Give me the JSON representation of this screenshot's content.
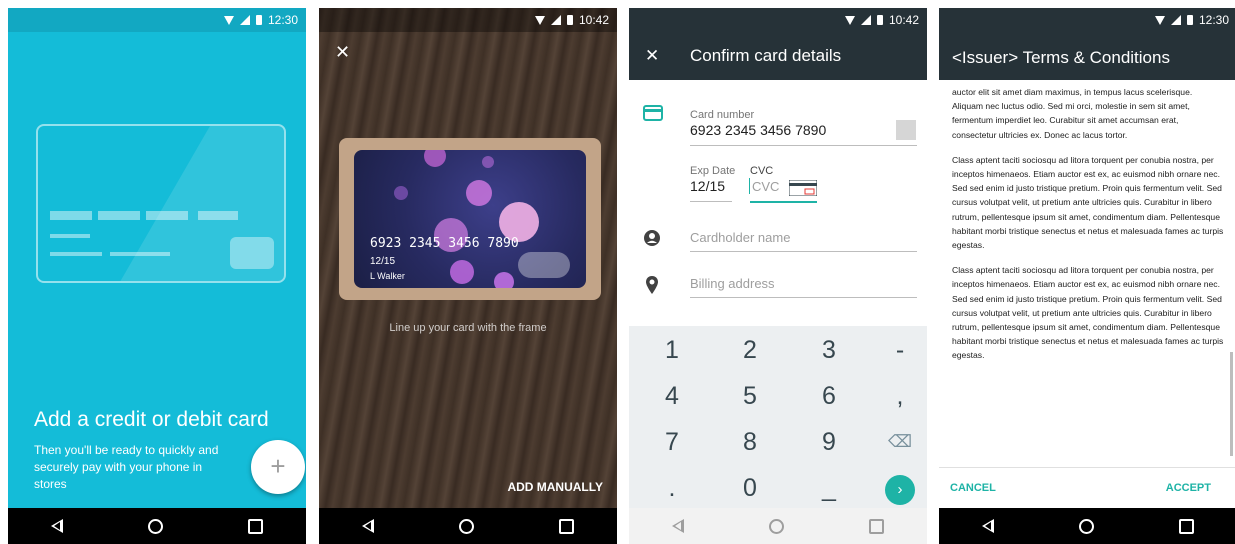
{
  "screen1": {
    "time": "12:30",
    "title": "Add a credit or debit card",
    "subtitle": "Then you'll be ready to quickly and securely pay with your phone in stores",
    "fab_icon": "+"
  },
  "screen2": {
    "time": "10:42",
    "close_icon": "✕",
    "card_number": "6923 2345 3456 7890",
    "card_expiry": "12/15",
    "card_name": "L Walker",
    "hint": "Line up your card with the frame",
    "add_manually": "ADD MANUALLY"
  },
  "screen3": {
    "time": "10:42",
    "close_icon": "✕",
    "title": "Confirm card details",
    "card_number_label": "Card number",
    "card_number_value": "6923 2345 3456 7890",
    "exp_label": "Exp Date",
    "exp_value": "12/15",
    "cvc_label": "CVC",
    "cvc_placeholder": "CVC",
    "cardholder_placeholder": "Cardholder name",
    "billing_placeholder": "Billing address",
    "keys": [
      "1",
      "2",
      "3",
      "-",
      "4",
      "5",
      "6",
      ",",
      "7",
      "8",
      "9",
      "⌫",
      ".",
      "0",
      "_"
    ],
    "go_icon": "›",
    "accent": "#1eb3a6"
  },
  "screen4": {
    "time": "12:30",
    "title": "<Issuer> Terms & Conditions",
    "paragraphs": [
      "auctor elit sit amet diam maximus, in tempus lacus scelerisque. Aliquam nec luctus odio. Sed mi orci, molestie in sem sit amet, fermentum imperdiet leo. Curabitur sit amet accumsan erat, consectetur ultricies ex. Donec ac lacus tortor.",
      "Class aptent taciti sociosqu ad litora torquent per conubia nostra, per inceptos himenaeos. Etiam auctor est ex, ac euismod nibh ornare nec. Sed sed enim id justo tristique pretium. Proin quis fermentum velit. Sed cursus volutpat velit, ut pretium ante ultricies quis. Curabitur in libero rutrum, pellentesque ipsum sit amet, condimentum diam. Pellentesque habitant morbi tristique senectus et netus et malesuada fames ac turpis egestas.",
      "Class aptent taciti sociosqu ad litora torquent per conubia nostra, per inceptos himenaeos. Etiam auctor est ex, ac euismod nibh ornare nec. Sed sed enim id justo tristique pretium. Proin quis fermentum velit. Sed cursus volutpat velit, ut pretium ante ultricies quis. Curabitur in libero rutrum, pellentesque ipsum sit amet, condimentum diam. Pellentesque habitant morbi tristique senectus et netus et malesuada fames ac turpis egestas."
    ],
    "cancel": "CANCEL",
    "accept": "ACCEPT",
    "accent": "#1eb3a6"
  }
}
